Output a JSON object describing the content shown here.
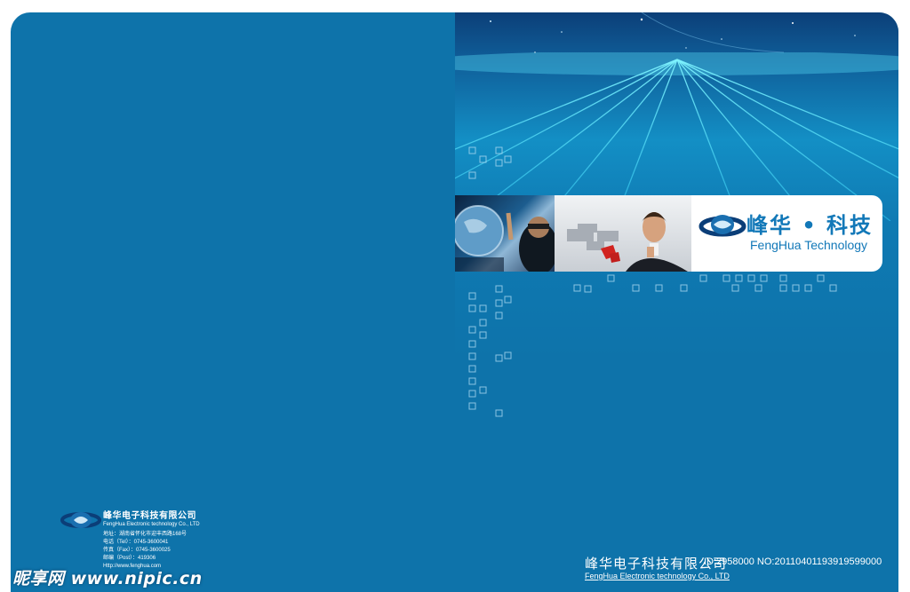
{
  "front": {
    "brand_cn": "峰华 • 科技",
    "brand_en": "FengHua Technology",
    "footer_company_cn": "峰华电子科技有限公司",
    "footer_company_en": "FengHua Electronic technology Co., LTD"
  },
  "back": {
    "company_cn": "峰华电子科技有限公司",
    "company_en": "FengHua Electronic technology Co., LTD",
    "address": "地址：湖南省怀化市迎丰西路168号",
    "tel": "电话（Tel）：0745-3600041",
    "fax": "传真（Fax）：0745-3600025",
    "post": "邮编（Post）：419306",
    "website": "Http://www.fenghua.com"
  },
  "watermark": {
    "site": "昵享网 www.nipic.cn",
    "id": "ID:2958000 NO:20110401193919599000"
  },
  "colors": {
    "cover_blue": "#0e73aa",
    "grid_cyan": "#4fe3ff",
    "logo_blue": "#1278b8"
  },
  "icons": {
    "logo": "swirl-logo-icon"
  }
}
